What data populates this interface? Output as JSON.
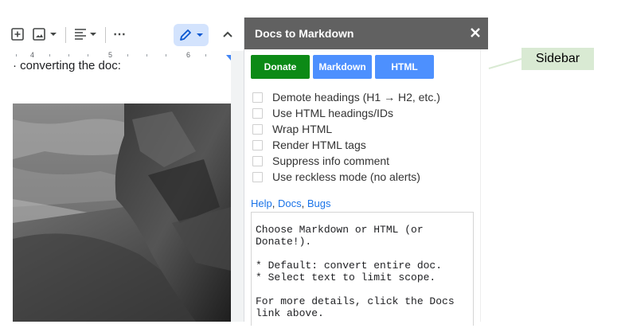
{
  "toolbar": {
    "icons": [
      "add-comment-icon",
      "insert-image-icon",
      "align-icon",
      "more-icon",
      "editing-mode-pencil-icon",
      "collapse-chevron-icon"
    ],
    "more_label": "⋯"
  },
  "ruler": {
    "numbers": [
      "4",
      "5",
      "6"
    ]
  },
  "document": {
    "text_line": "· converting the doc:",
    "image_alt": "Black and white photo of a rocky cliff on a beach with waves"
  },
  "sidebar": {
    "title": "Docs to Markdown",
    "close_label": "×",
    "buttons": {
      "donate": "Donate",
      "markdown": "Markdown",
      "html": "HTML"
    },
    "options": [
      "Demote headings (H1 → H2, etc.)",
      "Use HTML headings/IDs",
      "Wrap HTML",
      "Render HTML tags",
      "Suppress info comment",
      "Use reckless mode (no alerts)"
    ],
    "links": {
      "help": "Help",
      "docs": "Docs",
      "bugs": "Bugs",
      "separator": ", "
    },
    "output_text": "Choose Markdown or HTML (or\nDonate!).\n\n* Default: convert entire doc.\n* Select text to limit scope.\n\nFor more details, click the Docs\nlink above."
  },
  "annotation": {
    "label": "Sidebar"
  },
  "colors": {
    "header_bg": "#616161",
    "donate_green": "#0c8a16",
    "button_blue": "#4d90fe",
    "link_blue": "#1a73e8",
    "callout_bg": "#d9ead3"
  }
}
